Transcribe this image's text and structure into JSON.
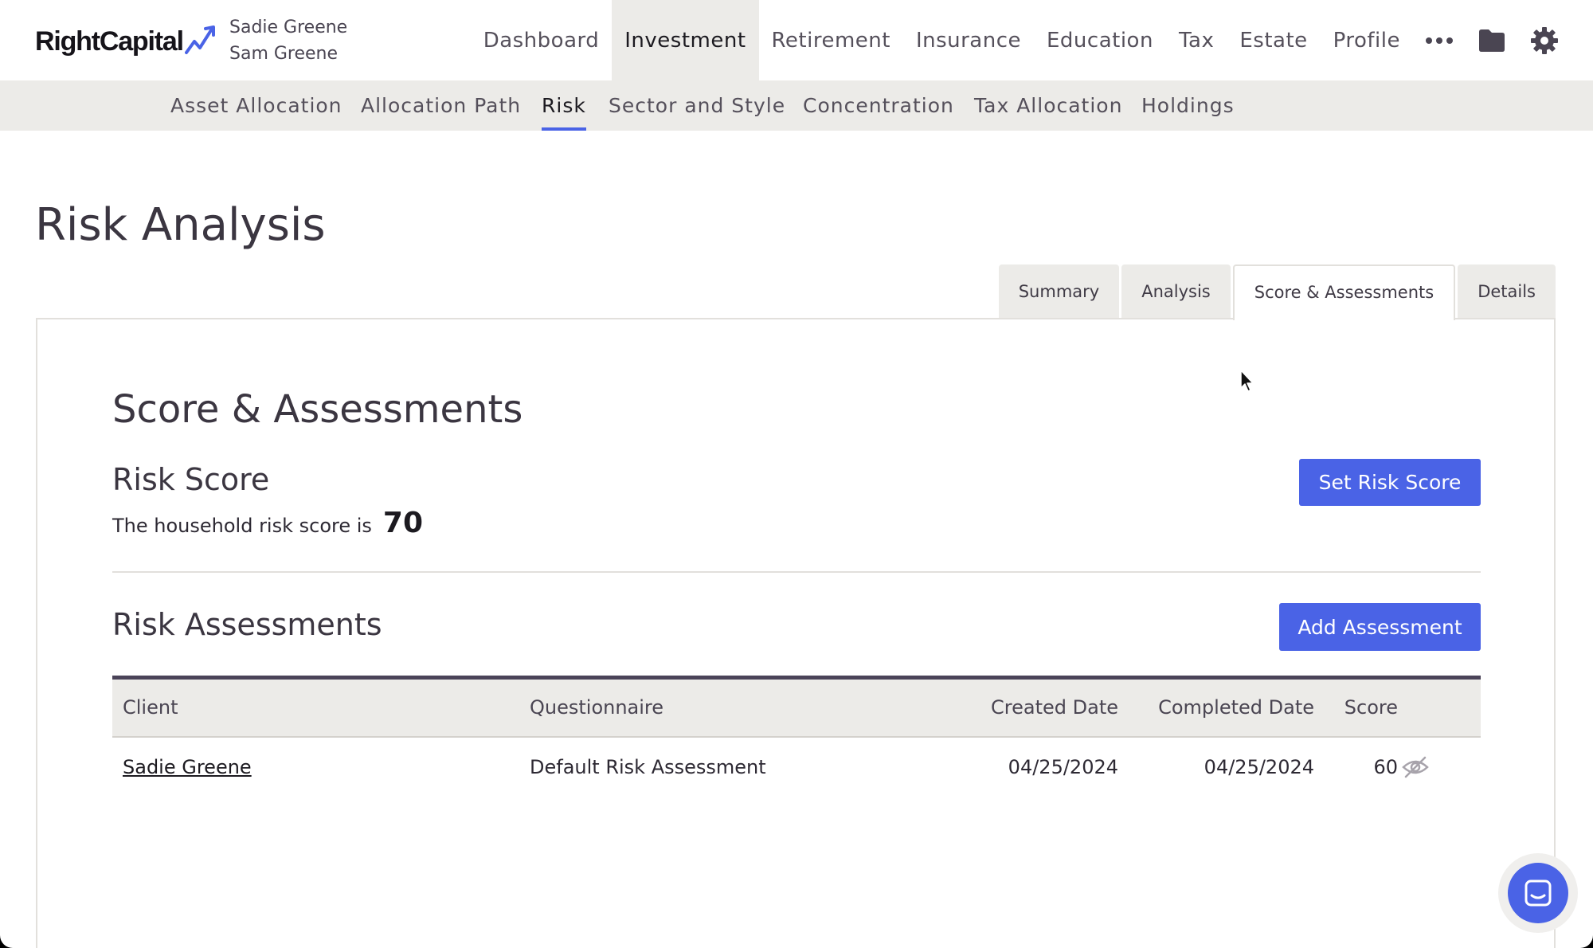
{
  "brand": {
    "name": "RightCapital",
    "accent": "#4a63e6"
  },
  "clients": [
    "Sadie Greene",
    "Sam Greene"
  ],
  "main_nav": [
    {
      "label": "Dashboard",
      "active": false
    },
    {
      "label": "Investment",
      "active": true
    },
    {
      "label": "Retirement",
      "active": false
    },
    {
      "label": "Insurance",
      "active": false
    },
    {
      "label": "Education",
      "active": false
    },
    {
      "label": "Tax",
      "active": false
    },
    {
      "label": "Estate",
      "active": false
    },
    {
      "label": "Profile",
      "active": false
    }
  ],
  "nav_icons": [
    "more-icon",
    "folder-icon",
    "gear-icon"
  ],
  "sub_nav": [
    {
      "label": "Asset Allocation",
      "active": false
    },
    {
      "label": "Allocation Path",
      "active": false
    },
    {
      "label": "Risk",
      "active": true
    },
    {
      "label": "Sector and Style",
      "active": false
    },
    {
      "label": "Concentration",
      "active": false
    },
    {
      "label": "Tax Allocation",
      "active": false
    },
    {
      "label": "Holdings",
      "active": false
    }
  ],
  "page_title": "Risk Analysis",
  "tabs": [
    {
      "label": "Summary",
      "active": false
    },
    {
      "label": "Analysis",
      "active": false
    },
    {
      "label": "Score & Assessments",
      "active": true
    },
    {
      "label": "Details",
      "active": false
    }
  ],
  "section": {
    "title": "Score & Assessments",
    "risk_score": {
      "heading": "Risk Score",
      "text": "The household risk score is",
      "value": "70",
      "button": "Set Risk Score"
    },
    "assessments": {
      "heading": "Risk Assessments",
      "button": "Add Assessment",
      "columns": [
        "Client",
        "Questionnaire",
        "Created Date",
        "Completed Date",
        "Score"
      ],
      "rows": [
        {
          "client": "Sadie Greene",
          "questionnaire": "Default Risk Assessment",
          "created": "04/25/2024",
          "completed": "04/25/2024",
          "score": "60",
          "action_icon": "eye-off-icon"
        }
      ]
    }
  },
  "chat_icon": "chat-icon"
}
